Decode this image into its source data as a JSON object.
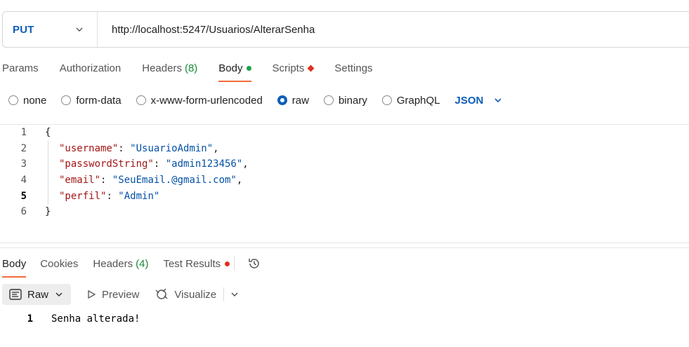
{
  "request": {
    "method": "PUT",
    "url": "http://localhost:5247/Usuarios/AlterarSenha"
  },
  "request_tabs": [
    {
      "label": "Params"
    },
    {
      "label": "Authorization"
    },
    {
      "label": "Headers",
      "count": "(8)"
    },
    {
      "label": "Body"
    },
    {
      "label": "Scripts"
    },
    {
      "label": "Settings"
    }
  ],
  "body_types": {
    "none": "none",
    "form_data": "form-data",
    "urlencoded": "x-www-form-urlencoded",
    "raw": "raw",
    "binary": "binary",
    "graphql": "GraphQL",
    "selected": "raw",
    "format": "JSON"
  },
  "editor": {
    "line_numbers": [
      "1",
      "2",
      "3",
      "4",
      "5",
      "6"
    ],
    "open_brace": "{",
    "close_brace": "}",
    "fields": [
      {
        "key": "\"username\"",
        "value": "\"UsuarioAdmin\"",
        "trail": ","
      },
      {
        "key": "\"passwordString\"",
        "value": "\"admin123456\"",
        "trail": ","
      },
      {
        "key": "\"email\"",
        "value": "\"SeuEmail.@gmail.com\"",
        "trail": ","
      },
      {
        "key": "\"perfil\"",
        "value": "\"Admin\"",
        "trail": ""
      }
    ]
  },
  "response_tabs": [
    {
      "label": "Body"
    },
    {
      "label": "Cookies"
    },
    {
      "label": "Headers",
      "count": "(4)"
    },
    {
      "label": "Test Results"
    }
  ],
  "response_toolbar": {
    "raw": "Raw",
    "preview": "Preview",
    "visualize": "Visualize"
  },
  "response_body": {
    "line": "1",
    "text": "Senha alterada!"
  },
  "colors": {
    "accent_orange": "#f26b3a",
    "method_blue": "#0e5fb8",
    "json_key": "#a31515",
    "json_string": "#0451a5"
  }
}
